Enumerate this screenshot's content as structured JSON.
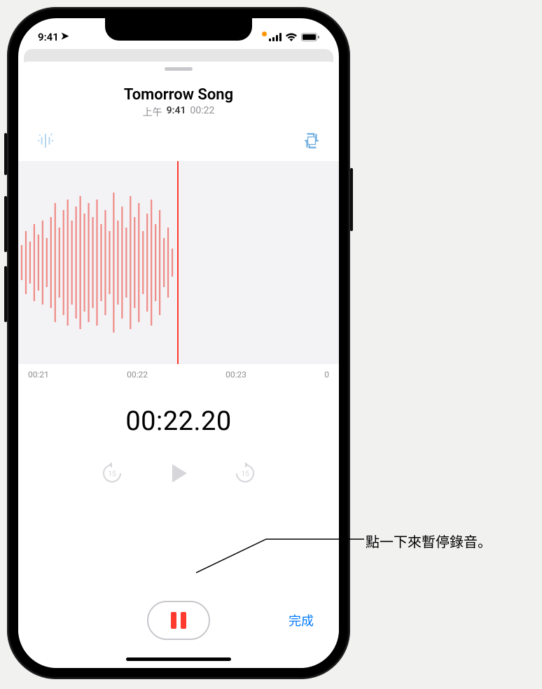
{
  "status": {
    "time": "9:41",
    "orange_dot": true
  },
  "recording": {
    "title": "Tomorrow Song",
    "time_prefix": "上午",
    "time_value": "9:41",
    "duration": "00:22"
  },
  "timeline": {
    "ticks": [
      "00:21",
      "00:22",
      "00:23",
      "0"
    ],
    "elapsed": "00:22.20"
  },
  "buttons": {
    "done": "完成"
  },
  "callout": {
    "text": "點一下來暫停錄音。"
  },
  "icons": {
    "enhance": "enhance-icon",
    "trim": "trim-icon",
    "back15": "back-15-icon",
    "play": "play-icon",
    "fwd15": "forward-15-icon",
    "pause": "pause-icon"
  }
}
